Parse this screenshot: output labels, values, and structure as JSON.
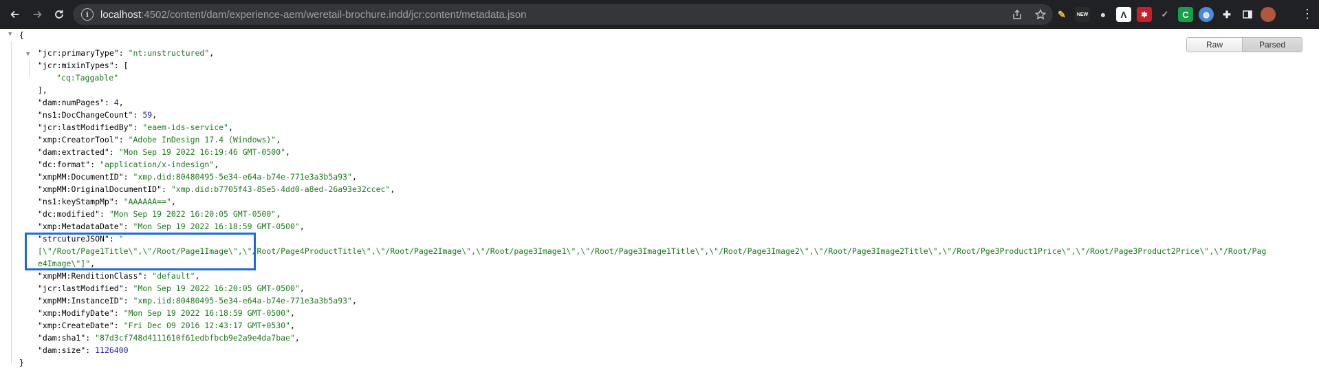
{
  "browser": {
    "url_host": "localhost",
    "url_rest": ":4502/content/dam/experience-aem/weretail-brochure.indd/jcr:content/metadata.json"
  },
  "viewer": {
    "raw_label": "Raw",
    "parsed_label": "Parsed",
    "active_mode": "Parsed"
  },
  "json": {
    "open_brace": "{",
    "close_brace": "}",
    "mixin_close": "],",
    "entries": [
      {
        "key": "\"jcr:primaryType\"",
        "value": "\"nt:unstructured\"",
        "type": "string",
        "comma": ","
      },
      {
        "key": "\"jcr:mixinTypes\"",
        "value": "[",
        "type": "punct",
        "comma": ""
      },
      {
        "key": "",
        "value": "\"cq:Taggable\"",
        "type": "string",
        "comma": ""
      },
      {
        "key": "\"dam:numPages\"",
        "value": "4",
        "type": "number",
        "comma": ","
      },
      {
        "key": "\"ns1:DocChangeCount\"",
        "value": "59",
        "type": "number",
        "comma": ","
      },
      {
        "key": "\"jcr:lastModifiedBy\"",
        "value": "\"eaem-ids-service\"",
        "type": "string",
        "comma": ","
      },
      {
        "key": "\"xmp:CreatorTool\"",
        "value": "\"Adobe InDesign 17.4 (Windows)\"",
        "type": "string",
        "comma": ","
      },
      {
        "key": "\"dam:extracted\"",
        "value": "\"Mon Sep 19 2022 16:19:46 GMT-0500\"",
        "type": "string",
        "comma": ","
      },
      {
        "key": "\"dc:format\"",
        "value": "\"application/x-indesign\"",
        "type": "string",
        "comma": ","
      },
      {
        "key": "\"xmpMM:DocumentID\"",
        "value": "\"xmp.did:80480495-5e34-e64a-b74e-771e3a3b5a93\"",
        "type": "string",
        "comma": ","
      },
      {
        "key": "\"xmpMM:OriginalDocumentID\"",
        "value": "\"xmp.did:b7705f43-85e5-4dd0-a8ed-26a93e32ccec\"",
        "type": "string",
        "comma": ","
      },
      {
        "key": "\"ns1:keyStampMp\"",
        "value": "\"AAAAAA==\"",
        "type": "string",
        "comma": ","
      },
      {
        "key": "\"dc:modified\"",
        "value": "\"Mon Sep 19 2022 16:20:05 GMT-0500\"",
        "type": "string",
        "comma": ","
      },
      {
        "key": "\"xmp:MetadataDate\"",
        "value": "\"Mon Sep 19 2022 16:18:59 GMT-0500\"",
        "type": "string",
        "comma": ","
      },
      {
        "key": "\"strcutureJSON\"",
        "value": "\"",
        "type": "string",
        "comma": ""
      },
      {
        "key": "",
        "value": "[\\\"/Root/Page1Title\\\",\\\"/Root/Page1Image\\\",\\\"/Root/Page4ProductTitle\\\",\\\"/Root/Page2Image\\\",\\\"/Root/page3Image1\\\",\\\"/Root/Page3Image1Title\\\",\\\"/Root/Page3Image2\\\",\\\"/Root/Page3Image2Title\\\",\\\"/Root/Pge3Product1Price\\\",\\\"/Root/Page3Product2Price\\\",\\\"/Root/Pag",
        "type": "string",
        "comma": ""
      },
      {
        "key": "",
        "value": "e4Image\\\"]\"",
        "type": "string",
        "comma": ","
      },
      {
        "key": "\"xmpMM:RenditionClass\"",
        "value": "\"default\"",
        "type": "string",
        "comma": ","
      },
      {
        "key": "\"jcr:lastModified\"",
        "value": "\"Mon Sep 19 2022 16:20:05 GMT-0500\"",
        "type": "string",
        "comma": ","
      },
      {
        "key": "\"xmpMM:InstanceID\"",
        "value": "\"xmp.iid:80480495-5e34-e64a-b74e-771e3a3b5a93\"",
        "type": "string",
        "comma": ","
      },
      {
        "key": "\"xmp:ModifyDate\"",
        "value": "\"Mon Sep 19 2022 16:18:59 GMT-0500\"",
        "type": "string",
        "comma": ","
      },
      {
        "key": "\"xmp:CreateDate\"",
        "value": "\"Fri Dec 09 2016 12:43:17 GMT+0530\"",
        "type": "string",
        "comma": ","
      },
      {
        "key": "\"dam:sha1\"",
        "value": "\"87d3cf748d4111610f61edbfbcb9e2a9e4da7bae\"",
        "type": "string",
        "comma": ","
      },
      {
        "key": "\"dam:size\"",
        "value": "1126400",
        "type": "number",
        "comma": ""
      }
    ]
  }
}
